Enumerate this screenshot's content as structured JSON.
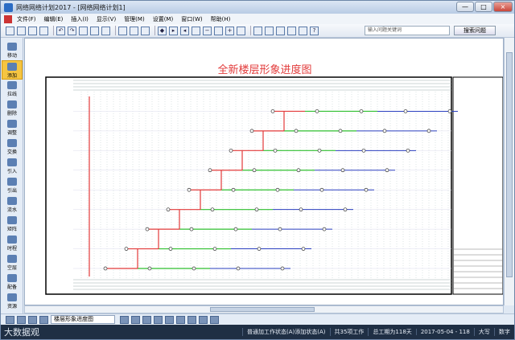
{
  "window": {
    "title": "网络网络计划2017 - [网络网络计划1]",
    "controls": [
      "—",
      "□",
      "×"
    ]
  },
  "menu": [
    "文件(F)",
    "编辑(E)",
    "插入(I)",
    "显示(V)",
    "管理(M)",
    "设置(M)",
    "窗口(W)",
    "帮助(H)"
  ],
  "search": {
    "placeholder": "输入问题关键词",
    "button": "搜索问题"
  },
  "left_tools": [
    {
      "label": "移动",
      "icon": "pointer-icon",
      "selected": false
    },
    {
      "label": "添加",
      "icon": "add-icon",
      "selected": true
    },
    {
      "label": "拉线",
      "icon": "pen-icon",
      "selected": false
    },
    {
      "label": "删除",
      "icon": "brush-icon",
      "selected": false
    },
    {
      "label": "调整",
      "icon": "adjust-icon",
      "selected": false
    },
    {
      "label": "交换",
      "icon": "swap-icon",
      "selected": false
    },
    {
      "label": "引入",
      "icon": "import-icon",
      "selected": false
    },
    {
      "label": "引出",
      "icon": "export-icon",
      "selected": false
    },
    {
      "label": "流水",
      "icon": "flow-icon",
      "selected": false
    },
    {
      "label": "矩阵",
      "icon": "matrix-icon",
      "selected": false
    },
    {
      "label": "时程",
      "icon": "house-icon",
      "selected": false
    },
    {
      "label": "空层",
      "icon": "layer-icon",
      "selected": false
    },
    {
      "label": "配备",
      "icon": "assign-icon",
      "selected": false
    },
    {
      "label": "资源",
      "icon": "resource-icon",
      "selected": false
    }
  ],
  "chart_title": "全新楼层形象进度图",
  "view_combo": "楼层形象进度图",
  "status": {
    "brand": "大数据观",
    "mode": "普通加工作状态(A)添加状态(A)",
    "count": "共35项工作",
    "total": "总工期为118天",
    "date": "2017-05-04 - 118",
    "caps": "大写",
    "num": "数字"
  },
  "colors": {
    "red": "#e23a3a",
    "green": "#2fbf2f",
    "blue": "#2a3fbf",
    "grid": "#9aa"
  }
}
